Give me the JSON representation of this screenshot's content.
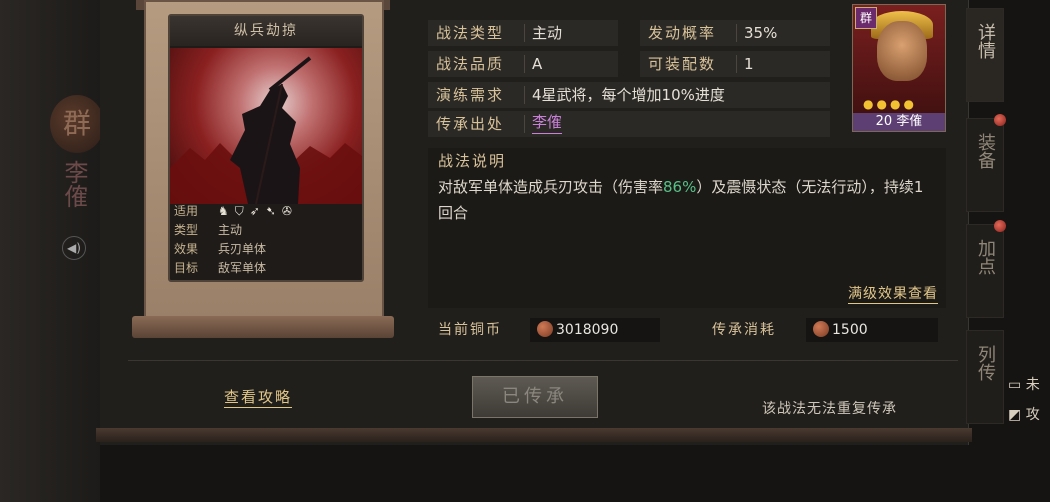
{
  "left_panel": {
    "emblem": "群",
    "hero_name": "李傕"
  },
  "skill_card": {
    "title": "纵兵劫掠",
    "rows": [
      {
        "label": "适用",
        "value": ""
      },
      {
        "label": "类型",
        "value": "主动"
      },
      {
        "label": "效果",
        "value": "兵刃单体"
      },
      {
        "label": "目标",
        "value": "敌军单体"
      }
    ],
    "unit_icons": [
      "cavalry-icon",
      "shield-icon",
      "bow-icon",
      "spear-icon",
      "siege-icon"
    ]
  },
  "attributes": {
    "type_label": "战法类型",
    "type_value": "主动",
    "rate_label": "发动概率",
    "rate_value": "35%",
    "quality_label": "战法品质",
    "quality_value": "A",
    "equip_label": "可装配数",
    "equip_value": "1",
    "drill_label": "演练需求",
    "drill_value": "4星武将，每个增加10%进度",
    "source_label": "传承出处",
    "source_value": "李傕"
  },
  "description": {
    "title": "战法说明",
    "text_before": "对敌军单体造成兵刃攻击（伤害率",
    "rate": "86%",
    "text_after": "）及震慑状态（无法行动），持续1回合",
    "full_effect_link": "满级效果查看"
  },
  "resources": {
    "copper_label": "当前铜币",
    "copper_value": "3018090",
    "cost_label": "传承消耗",
    "cost_value": "1500"
  },
  "hero": {
    "faction": "群",
    "level_name": "20 李傕",
    "stars": 4
  },
  "side_tabs": [
    "详情",
    "装备",
    "加点",
    "列传"
  ],
  "bottom": {
    "guide_link": "查看攻略",
    "inherited_button": "已传承",
    "note": "该战法无法重复传承"
  },
  "right_edge": {
    "item1": "未",
    "item2": "攻"
  }
}
